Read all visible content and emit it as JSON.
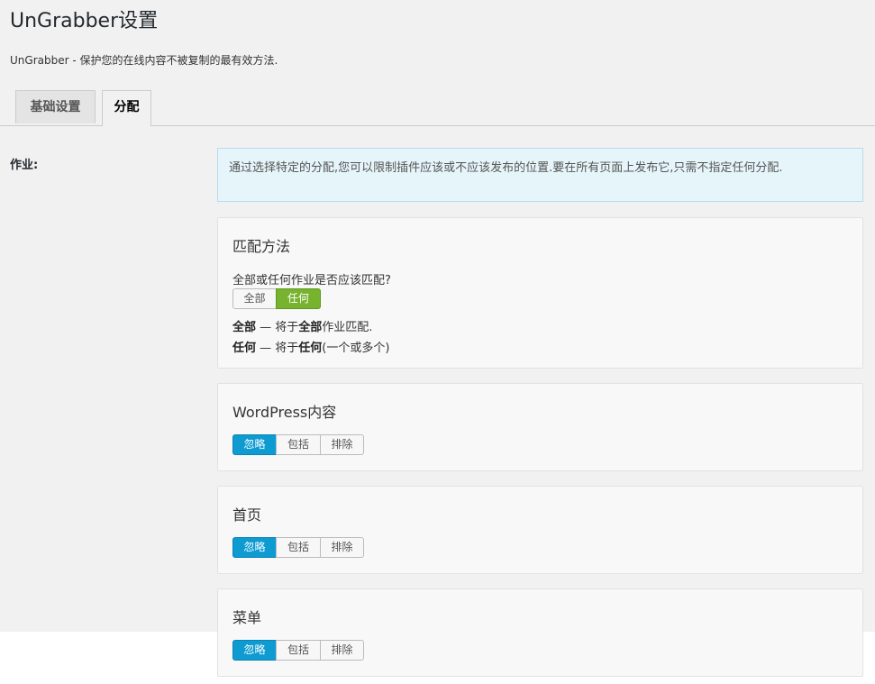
{
  "page": {
    "title": "UnGrabber设置",
    "description": "UnGrabber - 保护您的在线内容不被复制的最有效方法."
  },
  "tabs": [
    {
      "label": "基础设置",
      "active": false
    },
    {
      "label": "分配",
      "active": true
    }
  ],
  "assignments": {
    "label": "作业:",
    "notice": "通过选择特定的分配,您可以限制插件应该或不应该发布的位置.要在所有页面上发布它,只需不指定任何分配."
  },
  "match_method": {
    "title": "匹配方法",
    "question": "全部或任何作业是否应该匹配?",
    "options": [
      "全部",
      "任何"
    ],
    "selected": "任何",
    "explain_all": {
      "term": "全部",
      "dash": " — 将于",
      "strong": "全部",
      "rest": "作业匹配."
    },
    "explain_any": {
      "term": "任何",
      "dash": " — 将于",
      "strong": "任何",
      "rest": "(一个或多个)"
    }
  },
  "sections": [
    {
      "title": "WordPress内容",
      "options": [
        "忽略",
        "包括",
        "排除"
      ],
      "selected": "忽略"
    },
    {
      "title": "首页",
      "options": [
        "忽略",
        "包括",
        "排除"
      ],
      "selected": "忽略"
    },
    {
      "title": "菜单",
      "options": [
        "忽略",
        "包括",
        "排除"
      ],
      "selected": "忽略"
    }
  ],
  "colors": {
    "selected_blue": "#0e9bd2",
    "selected_green": "#77b32f",
    "notice_bg": "#e5f5fa"
  }
}
